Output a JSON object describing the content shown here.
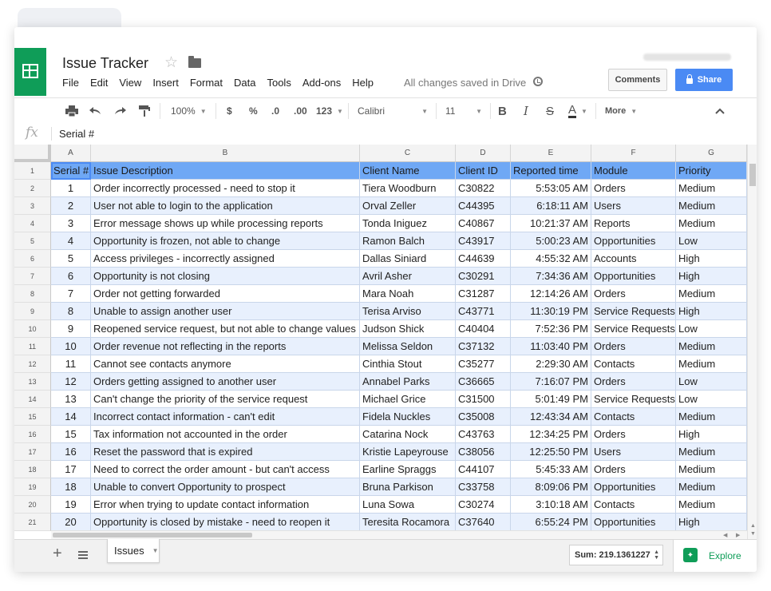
{
  "app": {
    "title": "Issue Tracker",
    "saved_status": "All changes saved in Drive",
    "comments_label": "Comments",
    "share_label": "Share"
  },
  "menu": [
    "File",
    "Edit",
    "View",
    "Insert",
    "Format",
    "Data",
    "Tools",
    "Add-ons",
    "Help"
  ],
  "toolbar": {
    "zoom": "100%",
    "currency": "$",
    "percent": "%",
    "dec_less": ".0",
    "dec_more": ".00",
    "more_formats": "123",
    "font": "Calibri",
    "font_size": "11",
    "bold": "B",
    "italic": "I",
    "strike": "S",
    "text_color": "A",
    "more": "More"
  },
  "formula_bar": {
    "fx": "fx",
    "value": "Serial #"
  },
  "columns": [
    "A",
    "B",
    "C",
    "D",
    "E",
    "F",
    "G"
  ],
  "header_row": [
    "Serial #",
    "Issue Description",
    "Client Name",
    "Client ID",
    "Reported time",
    "Module",
    "Priority"
  ],
  "rows": [
    [
      "1",
      "Order incorrectly processed - need to stop it",
      "Tiera Woodburn",
      "C30822",
      "5:53:05 AM",
      "Orders",
      "Medium"
    ],
    [
      "2",
      "User not able to login to the application",
      "Orval Zeller",
      "C44395",
      "6:18:11 AM",
      "Users",
      "Medium"
    ],
    [
      "3",
      "Error message shows up while processing reports",
      "Tonda Iniguez",
      "C40867",
      "10:21:37 AM",
      "Reports",
      "Medium"
    ],
    [
      "4",
      "Opportunity is frozen, not able to change",
      "Ramon Balch",
      "C43917",
      "5:00:23 AM",
      "Opportunities",
      "Low"
    ],
    [
      "5",
      "Access privileges - incorrectly assigned",
      "Dallas Siniard",
      "C44639",
      "4:55:32 AM",
      "Accounts",
      "High"
    ],
    [
      "6",
      "Opportunity is not closing",
      "Avril Asher",
      "C30291",
      "7:34:36 AM",
      "Opportunities",
      "High"
    ],
    [
      "7",
      "Order not getting forwarded",
      "Mara Noah",
      "C31287",
      "12:14:26 AM",
      "Orders",
      "Medium"
    ],
    [
      "8",
      "Unable to assign another user",
      "Terisa Arviso",
      "C43771",
      "11:30:19 PM",
      "Service Requests",
      "High"
    ],
    [
      "9",
      "Reopened service request, but not able to change values",
      "Judson Shick",
      "C40404",
      "7:52:36 PM",
      "Service Requests",
      "Low"
    ],
    [
      "10",
      "Order revenue not reflecting in the reports",
      "Melissa Seldon",
      "C37132",
      "11:03:40 PM",
      "Orders",
      "Medium"
    ],
    [
      "11",
      "Cannot see contacts anymore",
      "Cinthia Stout",
      "C35277",
      "2:29:30 AM",
      "Contacts",
      "Medium"
    ],
    [
      "12",
      "Orders getting assigned to another user",
      "Annabel Parks",
      "C36665",
      "7:16:07 PM",
      "Orders",
      "Low"
    ],
    [
      "13",
      "Can't change the priority of the service request",
      "Michael Grice",
      "C31500",
      "5:01:49 PM",
      "Service Requests",
      "Low"
    ],
    [
      "14",
      "Incorrect contact information - can't edit",
      "Fidela Nuckles",
      "C35008",
      "12:43:34 AM",
      "Contacts",
      "Medium"
    ],
    [
      "15",
      "Tax information not accounted in the order",
      "Catarina Nock",
      "C43763",
      "12:34:25 PM",
      "Orders",
      "High"
    ],
    [
      "16",
      "Reset the password that is expired",
      "Kristie Lapeyrouse",
      "C38056",
      "12:25:50 PM",
      "Users",
      "Medium"
    ],
    [
      "17",
      "Need to correct the order amount - but can't access",
      "Earline Spraggs",
      "C44107",
      "5:45:33 AM",
      "Orders",
      "Medium"
    ],
    [
      "18",
      "Unable to convert Opportunity to prospect",
      "Bruna Parkison",
      "C33758",
      "8:09:06 PM",
      "Opportunities",
      "Medium"
    ],
    [
      "19",
      "Error when trying to update contact information",
      "Luna Sowa",
      "C30274",
      "3:10:18 AM",
      "Contacts",
      "Medium"
    ],
    [
      "20",
      "Opportunity is closed by mistake - need to reopen it",
      "Teresita Rocamora",
      "C37640",
      "6:55:24 PM",
      "Opportunities",
      "High"
    ]
  ],
  "bottom": {
    "sheet_tab": "Issues",
    "sum": "Sum: 219.1361227",
    "explore": "Explore"
  },
  "colors": {
    "header_row": "#6fa8f5",
    "band": "#e8f0fd",
    "brand": "#0f9d58",
    "share": "#4a8af4"
  }
}
